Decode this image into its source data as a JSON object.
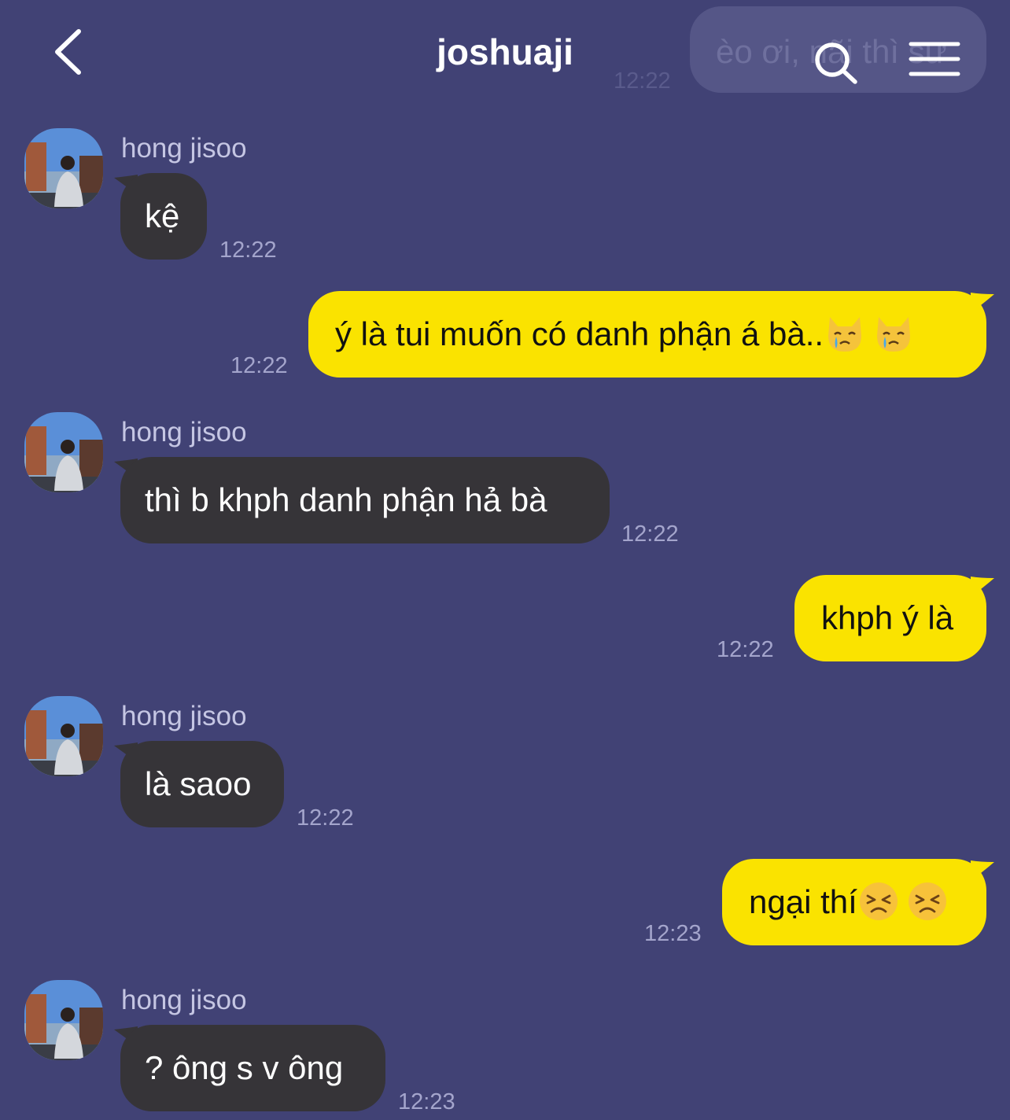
{
  "header": {
    "title": "joshuaji",
    "back_icon": "chevron-left-icon",
    "search_icon": "search-icon",
    "menu_icon": "hamburger-menu-icon"
  },
  "previous_message": {
    "text": "èo ơi, nãi thì sư",
    "time": "12:22"
  },
  "colors": {
    "background": "#414275",
    "incoming_bubble": "#363438",
    "outgoing_bubble": "#fae300",
    "time_text": "#a4a5cc",
    "sender_text": "#c5c6e3"
  },
  "messages": [
    {
      "direction": "in",
      "sender": "hong jisoo",
      "text": "kệ",
      "time": "12:22"
    },
    {
      "direction": "out",
      "text": "ý là tui muốn có danh phận á bà..",
      "emojis": [
        "crying-cat-emoji",
        "crying-cat-emoji"
      ],
      "time": "12:22"
    },
    {
      "direction": "in",
      "sender": "hong jisoo",
      "text": "thì b khph danh phận hả bà",
      "time": "12:22"
    },
    {
      "direction": "out",
      "text": "khph ý là",
      "time": "12:22"
    },
    {
      "direction": "in",
      "sender": "hong jisoo",
      "text": "là saoo",
      "time": "12:22"
    },
    {
      "direction": "out",
      "text": "ngại thí",
      "emojis": [
        "persevering-face-emoji",
        "persevering-face-emoji"
      ],
      "time": "12:23"
    },
    {
      "direction": "in",
      "sender": "hong jisoo",
      "text": "? ông s v ông",
      "time": "12:23"
    }
  ]
}
